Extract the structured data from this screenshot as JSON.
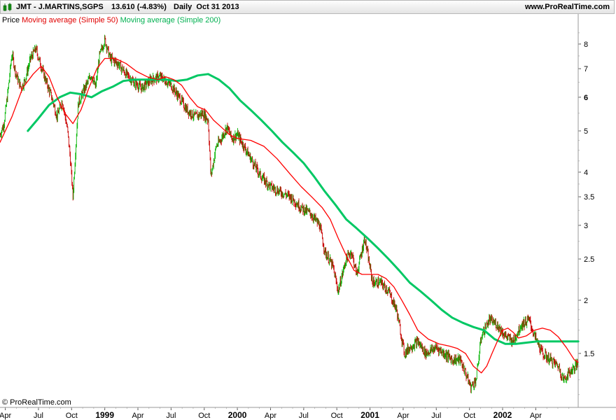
{
  "header": {
    "ticker": "JMT - J.MARTINS,SGPS",
    "price": "13.610 (-4.83%)",
    "period": "Daily  Oct 31 2013",
    "site": "www.ProRealTime.com"
  },
  "legend": {
    "price": "Price",
    "ma50": "Moving average (Simple 50)",
    "ma200": "Moving average (Simple 200)"
  },
  "copyright": "© ProRealTime.com",
  "colors": {
    "up": "#00b400",
    "down": "#c80000",
    "ma50": "#ff0000",
    "ma200": "#00c864",
    "icon": "#1aa01a"
  },
  "chart_data": {
    "type": "line",
    "scale": "log",
    "ylim": [
      1.12,
      9.2
    ],
    "xlim": [
      1998.21,
      2002.57
    ],
    "y_ticks": [
      {
        "v": 1.5,
        "label": "1.5",
        "bold": false
      },
      {
        "v": 2,
        "label": "2",
        "bold": false
      },
      {
        "v": 2.5,
        "label": "2.5",
        "bold": false
      },
      {
        "v": 3,
        "label": "3",
        "bold": false
      },
      {
        "v": 3.5,
        "label": "3.5",
        "bold": false
      },
      {
        "v": 4,
        "label": "4",
        "bold": false
      },
      {
        "v": 5,
        "label": "5",
        "bold": false
      },
      {
        "v": 6,
        "label": "6",
        "bold": true
      },
      {
        "v": 7,
        "label": "7",
        "bold": false
      },
      {
        "v": 8,
        "label": "8",
        "bold": false
      }
    ],
    "x_ticks": [
      {
        "t": 1998.25,
        "label": "Apr",
        "bold": false
      },
      {
        "t": 1998.5,
        "label": "Jul",
        "bold": false
      },
      {
        "t": 1998.75,
        "label": "Oct",
        "bold": false
      },
      {
        "t": 1999.0,
        "label": "1999",
        "bold": true
      },
      {
        "t": 1999.25,
        "label": "Apr",
        "bold": false
      },
      {
        "t": 1999.5,
        "label": "Jul",
        "bold": false
      },
      {
        "t": 1999.75,
        "label": "Oct",
        "bold": false
      },
      {
        "t": 2000.0,
        "label": "2000",
        "bold": true
      },
      {
        "t": 2000.25,
        "label": "Apr",
        "bold": false
      },
      {
        "t": 2000.5,
        "label": "Jul",
        "bold": false
      },
      {
        "t": 2000.75,
        "label": "Oct",
        "bold": false
      },
      {
        "t": 2001.0,
        "label": "2001",
        "bold": true
      },
      {
        "t": 2001.25,
        "label": "Apr",
        "bold": false
      },
      {
        "t": 2001.5,
        "label": "Jul",
        "bold": false
      },
      {
        "t": 2001.75,
        "label": "Oct",
        "bold": false
      },
      {
        "t": 2002.0,
        "label": "2002",
        "bold": true
      },
      {
        "t": 2002.25,
        "label": "Apr",
        "bold": false
      }
    ],
    "series": [
      {
        "name": "Price",
        "x": [
          1998.21,
          1998.24,
          1998.27,
          1998.3,
          1998.33,
          1998.37,
          1998.4,
          1998.44,
          1998.48,
          1998.52,
          1998.56,
          1998.6,
          1998.64,
          1998.68,
          1998.72,
          1998.74,
          1998.76,
          1998.8,
          1998.85,
          1998.9,
          1998.93,
          1998.96,
          1999.0,
          1999.04,
          1999.1,
          1999.16,
          1999.22,
          1999.28,
          1999.35,
          1999.42,
          1999.5,
          1999.56,
          1999.62,
          1999.68,
          1999.74,
          1999.78,
          1999.8,
          1999.84,
          1999.88,
          1999.92,
          1999.96,
          2000.0,
          2000.05,
          2000.12,
          2000.18,
          2000.25,
          2000.32,
          2000.4,
          2000.48,
          2000.55,
          2000.62,
          2000.66,
          2000.72,
          2000.76,
          2000.82,
          2000.86,
          2000.9,
          2000.96,
          2001.02,
          2001.08,
          2001.14,
          2001.2,
          2001.26,
          2001.3,
          2001.36,
          2001.42,
          2001.5,
          2001.56,
          2001.62,
          2001.68,
          2001.72,
          2001.76,
          2001.8,
          2001.84,
          2001.9,
          2001.96,
          2002.02,
          2002.08,
          2002.14,
          2002.2,
          2002.24,
          2002.3,
          2002.36,
          2002.42,
          2002.46,
          2002.5,
          2002.55,
          2002.57
        ],
        "values": [
          4.9,
          5.2,
          6.2,
          7.6,
          6.8,
          6.3,
          6.6,
          7.4,
          7.8,
          7.1,
          6.5,
          6.0,
          5.4,
          5.9,
          5.0,
          4.3,
          3.5,
          5.8,
          6.3,
          6.8,
          6.3,
          7.5,
          8.2,
          7.4,
          7.2,
          6.8,
          6.5,
          6.3,
          6.6,
          6.7,
          6.4,
          6.0,
          5.6,
          5.4,
          5.5,
          5.3,
          3.9,
          4.6,
          4.8,
          5.1,
          4.8,
          4.9,
          4.6,
          4.2,
          3.9,
          3.7,
          3.6,
          3.5,
          3.3,
          3.2,
          3.0,
          2.6,
          2.4,
          2.1,
          2.5,
          2.6,
          2.3,
          2.8,
          2.2,
          2.2,
          2.1,
          1.9,
          1.5,
          1.55,
          1.6,
          1.5,
          1.55,
          1.5,
          1.45,
          1.45,
          1.35,
          1.25,
          1.3,
          1.65,
          1.8,
          1.75,
          1.65,
          1.6,
          1.75,
          1.8,
          1.65,
          1.5,
          1.45,
          1.4,
          1.3,
          1.35,
          1.4,
          1.42
        ]
      },
      {
        "name": "Moving average (Simple 50)",
        "x": [
          1998.21,
          1998.3,
          1998.38,
          1998.46,
          1998.52,
          1998.58,
          1998.64,
          1998.7,
          1998.76,
          1998.82,
          1998.88,
          1998.94,
          1999.0,
          1999.08,
          1999.16,
          1999.24,
          1999.32,
          1999.4,
          1999.46,
          1999.52,
          1999.58,
          1999.64,
          1999.7,
          1999.76,
          1999.82,
          1999.88,
          1999.94,
          2000.0,
          2000.1,
          2000.2,
          2000.3,
          2000.4,
          2000.48,
          2000.56,
          2000.64,
          2000.7,
          2000.76,
          2000.82,
          2000.88,
          2000.94,
          2001.0,
          2001.06,
          2001.12,
          2001.18,
          2001.24,
          2001.3,
          2001.36,
          2001.44,
          2001.52,
          2001.6,
          2001.66,
          2001.72,
          2001.78,
          2001.84,
          2001.88,
          2001.92,
          2001.96,
          2002.0,
          2002.04,
          2002.08,
          2002.12,
          2002.18,
          2002.24,
          2002.3,
          2002.36,
          2002.42,
          2002.48,
          2002.54,
          2002.57
        ],
        "values": [
          4.7,
          5.4,
          6.3,
          6.8,
          7.1,
          6.7,
          6.0,
          5.5,
          5.2,
          5.6,
          6.3,
          7.0,
          7.4,
          7.4,
          7.2,
          6.9,
          6.7,
          6.6,
          6.7,
          6.6,
          6.4,
          6.0,
          5.7,
          5.6,
          5.3,
          5.1,
          4.9,
          4.8,
          4.75,
          4.6,
          4.3,
          3.95,
          3.7,
          3.5,
          3.3,
          3.1,
          2.8,
          2.55,
          2.35,
          2.3,
          2.3,
          2.3,
          2.25,
          2.15,
          2.0,
          1.85,
          1.7,
          1.62,
          1.58,
          1.56,
          1.54,
          1.5,
          1.4,
          1.35,
          1.4,
          1.5,
          1.6,
          1.7,
          1.72,
          1.68,
          1.63,
          1.65,
          1.7,
          1.72,
          1.7,
          1.64,
          1.55,
          1.45,
          1.43
        ]
      },
      {
        "name": "Moving average (Simple 200)",
        "x": [
          1998.42,
          1998.5,
          1998.58,
          1998.66,
          1998.74,
          1998.82,
          1998.9,
          1998.98,
          1999.06,
          1999.14,
          1999.22,
          1999.3,
          1999.38,
          1999.46,
          1999.54,
          1999.62,
          1999.7,
          1999.78,
          1999.86,
          1999.94,
          2000.02,
          2000.1,
          2000.18,
          2000.26,
          2000.34,
          2000.42,
          2000.5,
          2000.58,
          2000.66,
          2000.74,
          2000.82,
          2000.9,
          2000.98,
          2001.06,
          2001.14,
          2001.22,
          2001.3,
          2001.38,
          2001.46,
          2001.54,
          2001.62,
          2001.7,
          2001.78,
          2001.86,
          2001.94,
          2002.02,
          2002.1,
          2002.18,
          2002.26,
          2002.34,
          2002.42,
          2002.5,
          2002.57
        ],
        "values": [
          5.0,
          5.35,
          5.75,
          6.0,
          6.15,
          6.1,
          6.0,
          6.2,
          6.35,
          6.55,
          6.6,
          6.6,
          6.6,
          6.6,
          6.55,
          6.6,
          6.75,
          6.8,
          6.6,
          6.3,
          5.9,
          5.6,
          5.3,
          5.0,
          4.7,
          4.45,
          4.2,
          3.9,
          3.6,
          3.35,
          3.1,
          2.95,
          2.8,
          2.65,
          2.5,
          2.35,
          2.2,
          2.1,
          2.0,
          1.9,
          1.82,
          1.77,
          1.73,
          1.7,
          1.62,
          1.58,
          1.58,
          1.59,
          1.6,
          1.6,
          1.6,
          1.6,
          1.6
        ]
      }
    ]
  }
}
